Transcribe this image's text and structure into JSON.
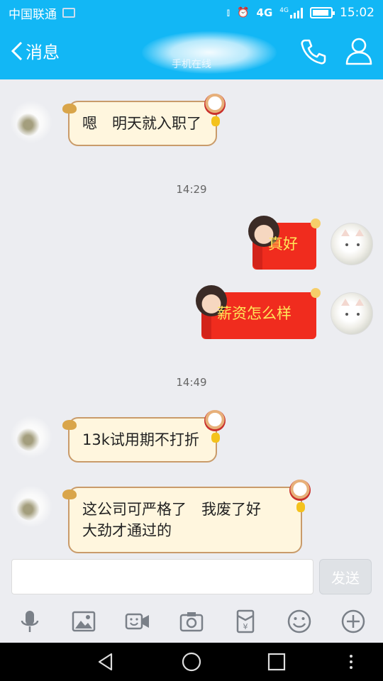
{
  "status_bar": {
    "carrier": "中国联通",
    "network": "4G",
    "network_small": "4G",
    "time": "15:02",
    "battery_level": 0.8
  },
  "header": {
    "back_label": "消息",
    "subtitle": "手机在线",
    "accent_color": "#12b7f5"
  },
  "messages": [
    {
      "direction": "incoming",
      "text": "嗯　明天就入职了"
    },
    {
      "type": "timestamp",
      "text": "14:29"
    },
    {
      "direction": "outgoing",
      "text": "真好"
    },
    {
      "direction": "outgoing",
      "text": "薪资怎么样"
    },
    {
      "type": "timestamp",
      "text": "14:49"
    },
    {
      "direction": "incoming",
      "text": "13k试用期不打折"
    },
    {
      "direction": "incoming",
      "lines": [
        "这公司可严格了　我废了好",
        "大劲才通过的"
      ]
    }
  ],
  "composer": {
    "input_value": "",
    "send_label": "发送"
  },
  "toolbar": {
    "items": [
      "microphone-icon",
      "image-icon",
      "video-icon",
      "camera-icon",
      "red-envelope-icon",
      "emoji-icon",
      "plus-icon"
    ]
  },
  "navbar": {
    "items": [
      "back-triangle-icon",
      "home-circle-icon",
      "recent-square-icon",
      "more-vertical-icon"
    ]
  }
}
